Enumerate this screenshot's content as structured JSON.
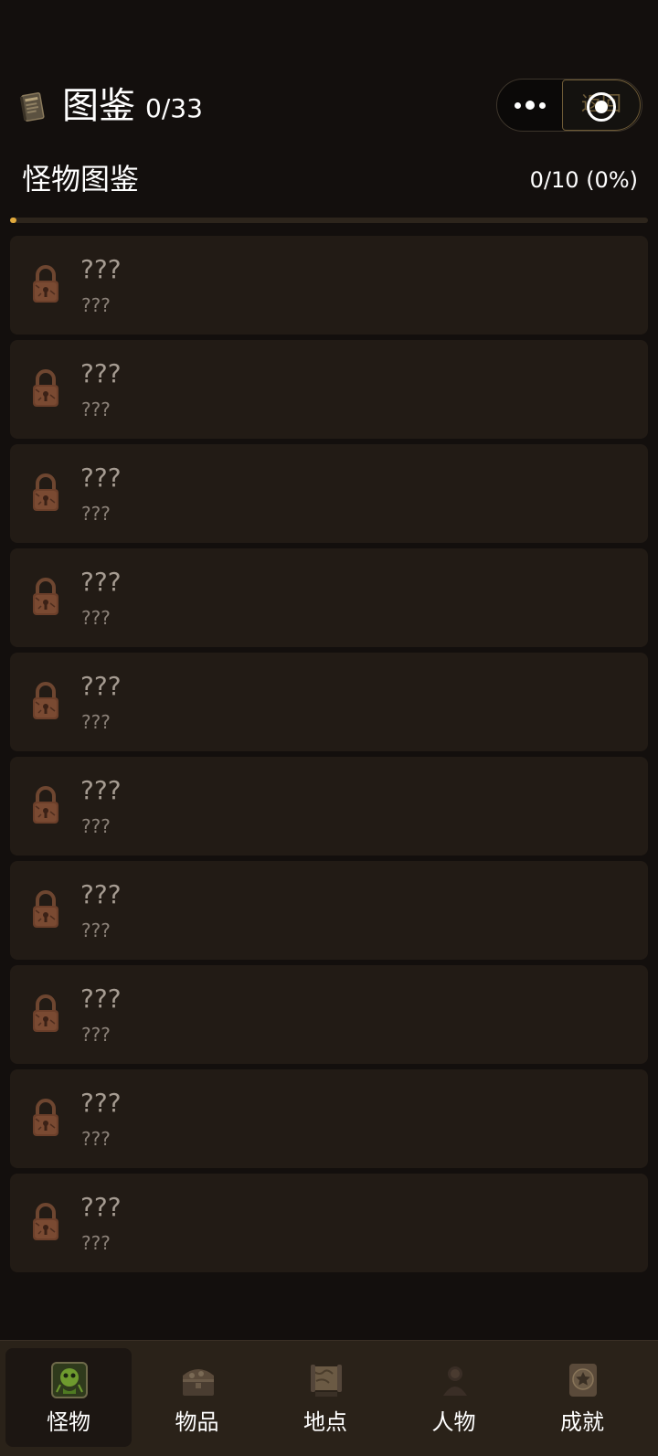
{
  "header": {
    "icon": "book-icon",
    "title": "图鉴",
    "count": "0/33",
    "capsule": {
      "more_icon": "more-dots-icon",
      "close_icon": "close-circle-icon",
      "close_overlay_text": "返回"
    }
  },
  "section": {
    "title": "怪物图鉴",
    "progress_text": "0/10 (0%)",
    "progress_fraction": 0,
    "accent_color": "#e0a93c"
  },
  "entries": [
    {
      "name": "???",
      "desc": "???",
      "icon": "lock-icon"
    },
    {
      "name": "???",
      "desc": "???",
      "icon": "lock-icon"
    },
    {
      "name": "???",
      "desc": "???",
      "icon": "lock-icon"
    },
    {
      "name": "???",
      "desc": "???",
      "icon": "lock-icon"
    },
    {
      "name": "???",
      "desc": "???",
      "icon": "lock-icon"
    },
    {
      "name": "???",
      "desc": "???",
      "icon": "lock-icon"
    },
    {
      "name": "???",
      "desc": "???",
      "icon": "lock-icon"
    },
    {
      "name": "???",
      "desc": "???",
      "icon": "lock-icon"
    },
    {
      "name": "???",
      "desc": "???",
      "icon": "lock-icon"
    },
    {
      "name": "???",
      "desc": "???",
      "icon": "lock-icon"
    }
  ],
  "tabbar": {
    "tabs": [
      {
        "label": "怪物",
        "icon": "monster-icon",
        "active": true
      },
      {
        "label": "物品",
        "icon": "treasure-chest-icon",
        "active": false
      },
      {
        "label": "地点",
        "icon": "map-scroll-icon",
        "active": false
      },
      {
        "label": "人物",
        "icon": "person-icon",
        "active": false
      },
      {
        "label": "成就",
        "icon": "achievement-badge-icon",
        "active": false
      }
    ]
  }
}
